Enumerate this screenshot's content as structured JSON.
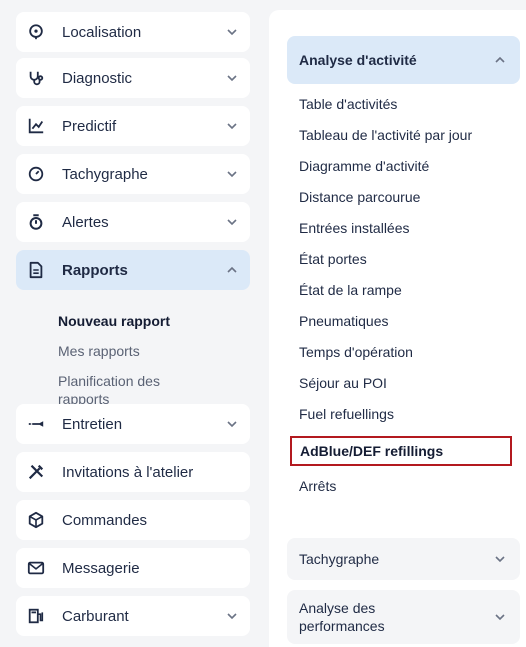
{
  "sidebar": {
    "items": [
      {
        "label": "Localisation",
        "icon": "location-pin-icon",
        "expanded": false
      },
      {
        "label": "Diagnostic",
        "icon": "stethoscope-icon",
        "expanded": false
      },
      {
        "label": "Predictif",
        "icon": "trend-chart-icon",
        "expanded": false
      },
      {
        "label": "Tachygraphe",
        "icon": "gauge-icon",
        "expanded": false
      },
      {
        "label": "Alertes",
        "icon": "stopwatch-icon",
        "expanded": false
      },
      {
        "label": "Rapports",
        "icon": "document-icon",
        "expanded": true,
        "active": true
      },
      {
        "label": "Entretien",
        "icon": "wrench-icon",
        "expanded": false
      },
      {
        "label": "Invitations à l'atelier",
        "icon": "tools-icon",
        "expanded": false
      },
      {
        "label": "Commandes",
        "icon": "box-icon",
        "expanded": false
      },
      {
        "label": "Messagerie",
        "icon": "mail-icon",
        "expanded": false
      },
      {
        "label": "Carburant",
        "icon": "fuel-pump-icon",
        "expanded": false
      }
    ],
    "rapports_sub": [
      {
        "label": "Nouveau rapport",
        "selected": true
      },
      {
        "label": "Mes rapports",
        "selected": false
      },
      {
        "label": "Planification des rapports",
        "selected": false
      }
    ]
  },
  "report_types": {
    "sections": [
      {
        "label": "Analyse d'activité",
        "expanded": true
      },
      {
        "label": "Tachygraphe",
        "expanded": false
      },
      {
        "label": "Analyse des performances",
        "expanded": false
      }
    ],
    "activity_links": [
      "Table d'activités",
      "Tableau de l'activité par jour",
      "Diagramme d'activité",
      "Distance parcourue",
      "Entrées installées",
      "État portes",
      "État de la rampe",
      "Pneumatiques",
      "Temps d'opération",
      "Séjour au POI",
      "Fuel refuellings",
      "AdBlue/DEF refillings",
      "Arrêts"
    ],
    "highlighted_link": "AdBlue/DEF refillings"
  },
  "colors": {
    "accent_bg": "#dbe9f8",
    "highlight_border": "#b3191f",
    "text": "#1f2a44",
    "muted_text": "#5a6274"
  }
}
